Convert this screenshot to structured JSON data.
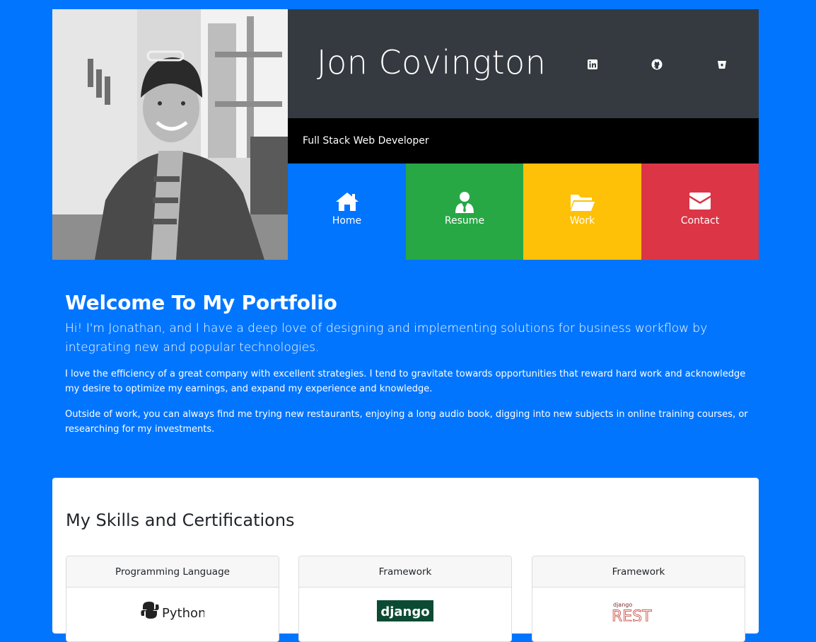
{
  "header": {
    "name": "Jon Covington",
    "subtitle": "Full Stack Web Developer",
    "social_icons": [
      "linkedin-icon",
      "github-icon",
      "bitbucket-icon"
    ]
  },
  "nav": {
    "tiles": [
      {
        "label": "Home",
        "icon": "home-icon",
        "color": "#0275ff"
      },
      {
        "label": "Resume",
        "icon": "user-tie-icon",
        "color": "#28a745"
      },
      {
        "label": "Work",
        "icon": "folder-open-icon",
        "color": "#ffc107"
      },
      {
        "label": "Contact",
        "icon": "envelope-icon",
        "color": "#dc3545"
      }
    ]
  },
  "intro": {
    "heading": "Welcome To My Portfolio",
    "lead": "Hi! I'm Jonathan, and I have a deep love of designing and implementing solutions for business workflow by integrating new and popular technologies.",
    "paragraph1": "I love the efficiency of a great company with excellent strategies. I tend to gravitate towards opportunities that reward hard work and acknowledge my desire to optimize my earnings, and expand my experience and knowledge.",
    "paragraph2": "Outside of work, you can always find me trying new restaurants, enjoying a long audio book, digging into new subjects in online training courses, or researching for my investments."
  },
  "skills": {
    "heading": "My Skills and Certifications",
    "cards": [
      {
        "category": "Programming Language",
        "logo_text": "Python"
      },
      {
        "category": "Framework",
        "logo_text": "django"
      },
      {
        "category": "Framework",
        "logo_text": "django",
        "logo_sub": "REST"
      }
    ]
  },
  "colors": {
    "page_bg": "#0275ff",
    "name_panel": "#343a40",
    "title_panel": "#000000"
  }
}
